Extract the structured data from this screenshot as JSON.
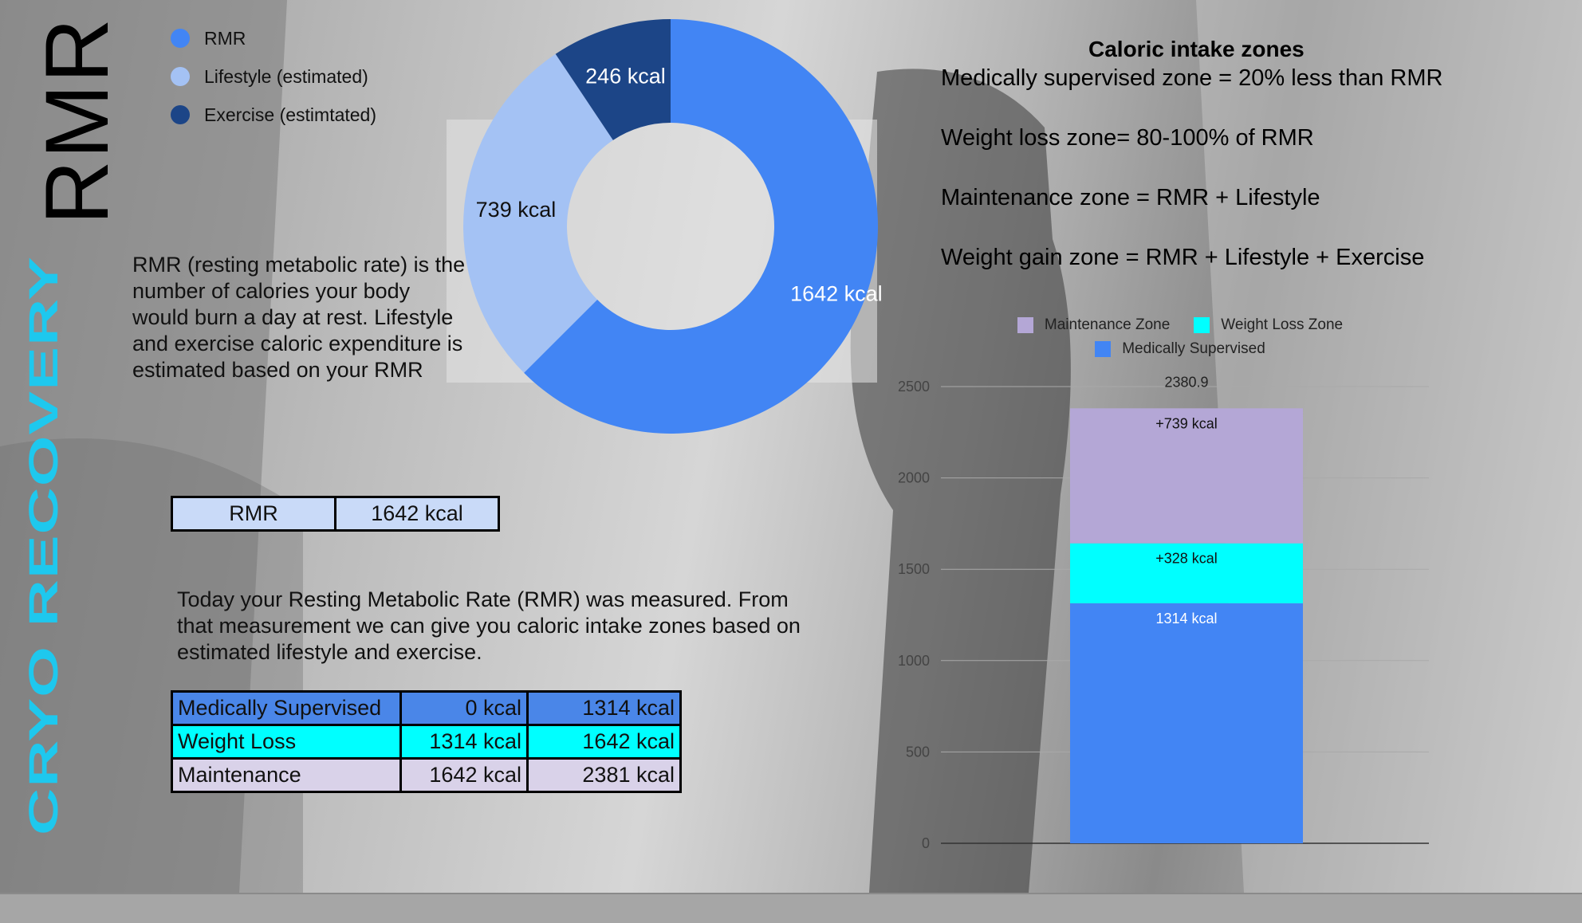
{
  "titles": {
    "rmr": "RMR",
    "brand": "CRYO RECOVERY"
  },
  "legend": [
    {
      "label": "RMR",
      "color": "#4285f4"
    },
    {
      "label": "Lifestyle (estimated)",
      "color": "#a4c2f4"
    },
    {
      "label": "Exercise (estimtated)",
      "color": "#1c4587"
    }
  ],
  "rmr_description": "RMR (resting metabolic rate) is the number of calories your body would burn a day at rest. Lifestyle and exercise caloric expenditure is estimated based on your RMR",
  "rmr_table": {
    "label": "RMR",
    "value": "1642 kcal"
  },
  "today_text": "Today your Resting Metabolic Rate (RMR) was measured. From that measurement we can give you caloric intake zones based on estimated lifestyle and exercise.",
  "zones_table": [
    {
      "name": "Medically Supervised",
      "from": "0 kcal",
      "to": "1314 kcal",
      "color": "#4a86e8"
    },
    {
      "name": "Weight Loss",
      "from": "1314 kcal",
      "to": "1642 kcal",
      "color": "#00ffff"
    },
    {
      "name": "Maintenance",
      "from": "1642 kcal",
      "to": "2381 kcal",
      "color": "#d9d2e9"
    }
  ],
  "zones_info": {
    "heading": "Caloric intake zones",
    "lines": [
      "Medically supervised zone = 20% less than RMR",
      "Weight loss zone= 80-100% of RMR",
      "Maintenance zone = RMR + Lifestyle",
      "Weight gain zone = RMR + Lifestyle + Exercise"
    ]
  },
  "chart_data": [
    {
      "type": "pie",
      "donut": true,
      "slices": [
        {
          "name": "RMR",
          "value": 1642,
          "label": "1642 kcal",
          "color": "#4285f4"
        },
        {
          "name": "Lifestyle (estimated)",
          "value": 739,
          "label": "739 kcal",
          "color": "#a4c2f4"
        },
        {
          "name": "Exercise (estimtated)",
          "value": 246,
          "label": "246 kcal",
          "color": "#1c4587"
        }
      ]
    },
    {
      "type": "bar",
      "stacked": true,
      "legend": "top",
      "ylim": [
        0,
        2500
      ],
      "yticks": [
        0,
        500,
        1000,
        1500,
        2000,
        2500
      ],
      "grid": true,
      "total_label": "2380.9",
      "series": [
        {
          "name": "Medically Supervised",
          "values": [
            1314
          ],
          "label": "1314 kcal",
          "color": "#4285f4"
        },
        {
          "name": "Weight Loss Zone",
          "values": [
            328
          ],
          "label": "+328 kcal",
          "color": "#00ffff"
        },
        {
          "name": "Maintenance Zone",
          "values": [
            739
          ],
          "label": "+739 kcal",
          "color": "#b4a7d6"
        }
      ]
    }
  ]
}
